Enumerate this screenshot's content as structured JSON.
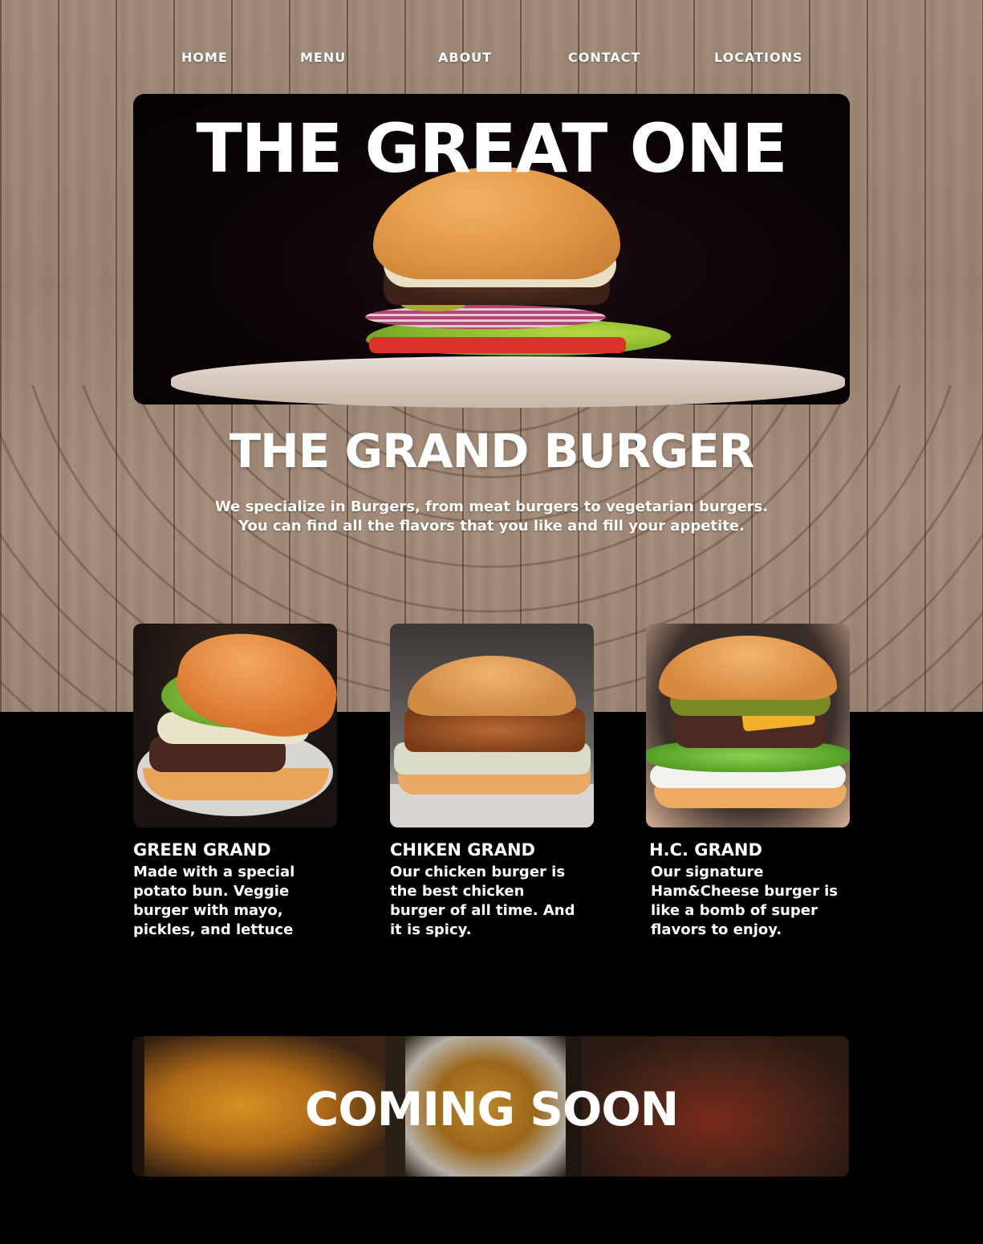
{
  "nav": {
    "items": [
      {
        "label": "HOME"
      },
      {
        "label": "MENU"
      },
      {
        "label": "ABOUT"
      },
      {
        "label": "CONTACT"
      },
      {
        "label": "LOCATIONS"
      }
    ]
  },
  "hero": {
    "title": "THE GREAT ONE"
  },
  "intro": {
    "title": "THE GRAND BURGER",
    "line1": "We specialize in Burgers, from meat burgers to vegetarian burgers.",
    "line2": "You can find all the flavors that you like and fill your appetite."
  },
  "cards": [
    {
      "title": "GREEN GRAND",
      "lines": [
        "Made with a special",
        "potato bun. Veggie",
        "burger with mayo,",
        "pickles, and lettuce"
      ]
    },
    {
      "title": "CHIKEN GRAND",
      "lines": [
        "Our chicken burger is",
        "the best chicken",
        "burger of all time. And",
        "it is spicy."
      ]
    },
    {
      "title": "H.C. GRAND",
      "lines": [
        "Our signature",
        "Ham&Cheese burger is",
        "like a bomb of super",
        "flavors to enjoy."
      ]
    }
  ],
  "banner": {
    "title": "COMING SOON"
  },
  "colors": {
    "background": "#000000",
    "wood": "#a08a78",
    "text": "#ffffff"
  }
}
